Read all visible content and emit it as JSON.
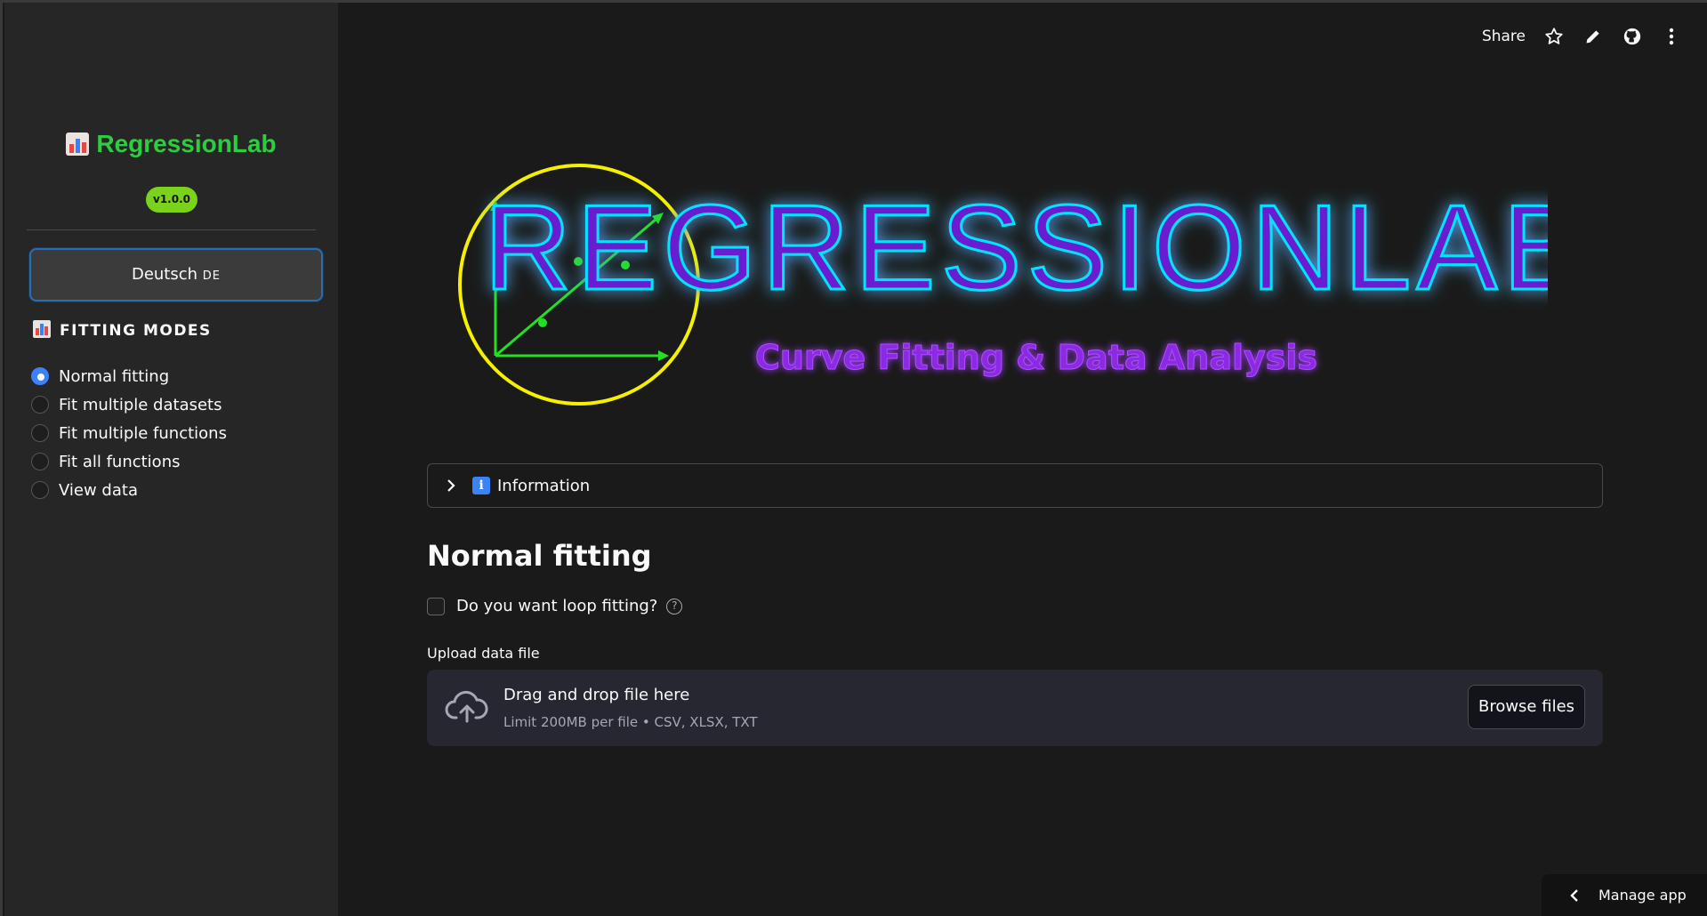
{
  "sidebar": {
    "brand": "RegressionLab",
    "version": "v1.0.0",
    "language_button": "Deutsch",
    "language_code": "DE",
    "modes_title": "FITTING MODES",
    "modes": [
      {
        "label": "Normal fitting",
        "selected": true
      },
      {
        "label": "Fit multiple datasets",
        "selected": false
      },
      {
        "label": "Fit multiple functions",
        "selected": false
      },
      {
        "label": "Fit all functions",
        "selected": false
      },
      {
        "label": "View data",
        "selected": false
      }
    ]
  },
  "toolbar": {
    "share": "Share",
    "icons": [
      "star-icon",
      "pencil-icon",
      "github-icon",
      "more-vertical-icon"
    ]
  },
  "hero": {
    "logo_text": "REGRESSIONLAB",
    "tagline": "Curve Fitting & Data Analysis"
  },
  "main": {
    "expander_label": "Information",
    "page_title": "Normal fitting",
    "loop_question": "Do you want loop fitting?",
    "upload_label": "Upload data file",
    "dropzone_main": "Drag and drop file here",
    "dropzone_sub": "Limit 200MB per file • CSV, XLSX, TXT",
    "browse_button": "Browse files"
  },
  "footer": {
    "manage_app": "Manage app"
  },
  "colors": {
    "accent_green": "#2ecc40",
    "badge_green": "#7bd21c",
    "primary_blue": "#3b82f6",
    "logo_purple": "#8a2be2",
    "logo_glow": "#00e5ff",
    "logo_circle": "#f5f000"
  }
}
